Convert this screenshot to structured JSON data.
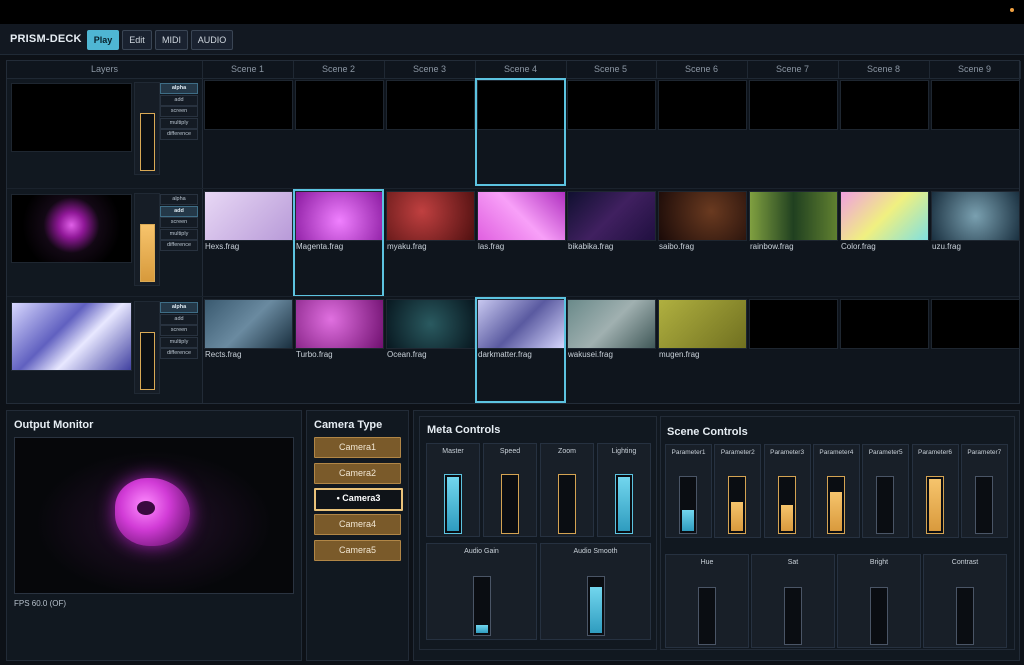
{
  "app": {
    "name": "PRISM-DECK"
  },
  "modes": [
    "Play",
    "Edit",
    "MIDI",
    "AUDIO"
  ],
  "active_mode": "Play",
  "grid": {
    "layers_header": "Layers",
    "scenes": [
      "Scene 1",
      "Scene 2",
      "Scene 3",
      "Scene 4",
      "Scene 5",
      "Scene 6",
      "Scene 7",
      "Scene 8",
      "Scene 9"
    ],
    "blend_modes": [
      "alpha",
      "add",
      "screen",
      "multiply",
      "difference"
    ],
    "layers": [
      {
        "active_blend": "alpha",
        "opacity": 0.0,
        "selected_scene": 4,
        "clips": [
          "",
          "",
          "",
          "",
          "",
          "",
          "",
          "",
          ""
        ]
      },
      {
        "active_blend": "add",
        "opacity": 1.0,
        "selected_scene": 2,
        "clips": [
          "Hexs.frag",
          "Magenta.frag",
          "myaku.frag",
          "las.frag",
          "bikabika.frag",
          "saibo.frag",
          "rainbow.frag",
          "Color.frag",
          "uzu.frag"
        ]
      },
      {
        "active_blend": "alpha",
        "opacity": 0.0,
        "selected_scene": 4,
        "clips": [
          "Rects.frag",
          "Turbo.frag",
          "Ocean.frag",
          "darkmatter.frag",
          "wakusei.frag",
          "mugen.frag",
          "",
          "",
          ""
        ]
      }
    ]
  },
  "output": {
    "title": "Output Monitor",
    "fps": "FPS 60.0 (OF)"
  },
  "camera": {
    "title": "Camera Type",
    "options": [
      "Camera1",
      "Camera2",
      "• Camera3",
      "Camera4",
      "Camera5"
    ],
    "active_index": 2
  },
  "meta": {
    "title": "Meta Controls",
    "controls": [
      {
        "label": "Master",
        "value": 1.0,
        "color": "cyan"
      },
      {
        "label": "Speed",
        "value": 0.0,
        "color": "gold"
      },
      {
        "label": "Zoom",
        "value": 0.0,
        "color": "gold"
      },
      {
        "label": "Lighting",
        "value": 1.0,
        "color": "cyan"
      },
      {
        "label": "Audio Gain",
        "value": 0.15,
        "color": "gray"
      },
      {
        "label": "Audio Smooth",
        "value": 0.85,
        "color": "gray"
      }
    ]
  },
  "scene_controls": {
    "title": "Scene Controls",
    "params": [
      {
        "label": "Parameter1",
        "value": 0.4,
        "color": "gray"
      },
      {
        "label": "Parameter2",
        "value": 0.55,
        "color": "gold"
      },
      {
        "label": "Parameter3",
        "value": 0.5,
        "color": "gold"
      },
      {
        "label": "Parameter4",
        "value": 0.75,
        "color": "gold"
      },
      {
        "label": "Parameter5",
        "value": 0.0,
        "color": "gray"
      },
      {
        "label": "Parameter6",
        "value": 1.0,
        "color": "gold"
      },
      {
        "label": "Parameter7",
        "value": 0.0,
        "color": "gray"
      }
    ],
    "color_params": [
      {
        "label": "Hue",
        "value": 0.0
      },
      {
        "label": "Sat",
        "value": 0.0
      },
      {
        "label": "Bright",
        "value": 0.0
      },
      {
        "label": "Contrast",
        "value": 0.0
      }
    ]
  },
  "colors": {
    "accent": "#4fb6d3",
    "gold": "#d9a955",
    "background": "#0d1117"
  }
}
